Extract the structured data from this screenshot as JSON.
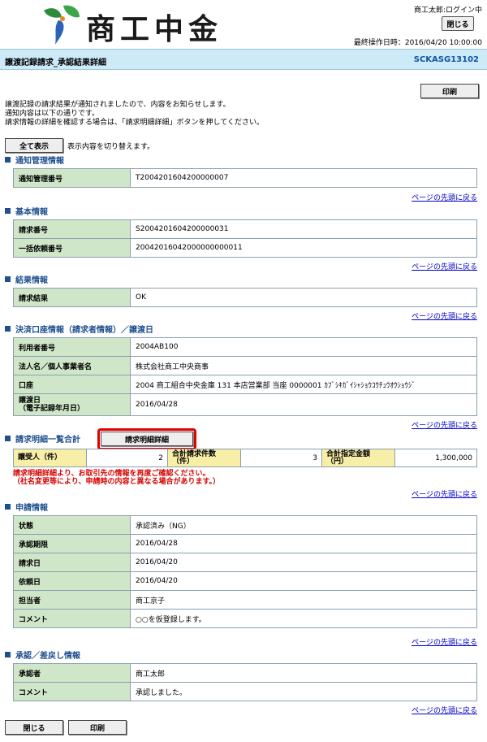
{
  "header": {
    "logo_text": "商工中金",
    "user_status": "商工太郎:ログイン中",
    "logout_label": "閉じる",
    "last_operation": "最終操作日時：2016/04/20 10:00:00"
  },
  "titlebar": {
    "title": "譲渡記録請求_承認結果詳細",
    "screen_id": "SCKASG13102"
  },
  "print_top_label": "印刷",
  "intro": [
    "譲渡記録の請求結果が通知されましたので、内容をお知らせします。",
    "通知内容は以下の通りです。",
    "請求情報の詳細を確認する場合は、「請求明細詳細」ボタンを押してください。"
  ],
  "show_all_label": "全て表示",
  "toggle_note": "表示内容を切り替えます。",
  "top_link_label": "ページの先頭に戻る",
  "sections": {
    "notice": {
      "title": "通知管理情報",
      "rows": [
        {
          "label": "通知管理番号",
          "value": "T2004201604200000007"
        }
      ]
    },
    "basic": {
      "title": "基本情報",
      "rows": [
        {
          "label": "請求番号",
          "value": "S2004201604200000031"
        },
        {
          "label": "一括依頼番号",
          "value": "20042016042000000000011"
        }
      ]
    },
    "result": {
      "title": "結果情報",
      "rows": [
        {
          "label": "請求結果",
          "value": "OK"
        }
      ]
    },
    "account": {
      "title": "決済口座情報（請求者情報）／譲渡日",
      "rows": [
        {
          "label": "利用者番号",
          "value": "2004AB100"
        },
        {
          "label": "法人名／個人事業者名",
          "value": "株式会社商工中央商事"
        },
        {
          "label": "口座",
          "value": "2004 商工組合中央金庫 131 本店営業部 当座 0000001 ｶﾌﾞｼｷｶﾞｲｼｬｼｮｳｺｳﾁｭｳｵｳｼｮｳｼﾞ"
        },
        {
          "label": "譲渡日",
          "label2": "（電子記録年月日）",
          "value": "2016/04/28"
        }
      ]
    },
    "summary": {
      "title": "請求明細一覧合計",
      "detail_button": "請求明細詳細",
      "cells": [
        {
          "label": "譲受人（件）",
          "value": "2"
        },
        {
          "label": "合計請求件数",
          "label2": "（件）",
          "value": "3"
        },
        {
          "label": "合計指定金額",
          "label2": "（円）",
          "value": "1,300,000"
        }
      ],
      "warning": [
        "請求明細詳細より、お取引先の情報を再度ご確認ください。",
        "（社名変更等により、申請時の内容と異なる場合があります。）"
      ]
    },
    "application": {
      "title": "申請情報",
      "rows": [
        {
          "label": "状態",
          "value": "承認済み（NG）"
        },
        {
          "label": "承認期限",
          "value": "2016/04/28"
        },
        {
          "label": "請求日",
          "value": "2016/04/20"
        },
        {
          "label": "依頼日",
          "value": "2016/04/20"
        },
        {
          "label": "担当者",
          "value": "商工京子"
        },
        {
          "label": "コメント",
          "value": "○○を仮登録します。"
        }
      ]
    },
    "approval": {
      "title": "承認／差戻し情報",
      "rows": [
        {
          "label": "承認者",
          "value": "商工太郎"
        },
        {
          "label": "コメント",
          "value": "承認しました。"
        }
      ]
    }
  },
  "footer": {
    "close_label": "閉じる",
    "print_label": "印刷"
  }
}
